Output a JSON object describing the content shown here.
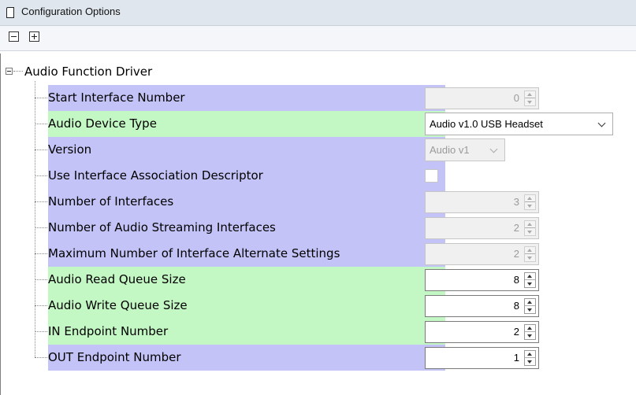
{
  "window": {
    "title": "Configuration Options"
  },
  "toolbar": {
    "collapse_all_icon": "minus-box-icon",
    "expand_all_icon": "plus-box-icon"
  },
  "tree": {
    "root_label": "Audio Function Driver",
    "rows": [
      {
        "label": "Start Interface Number",
        "control": "spinner",
        "value": "0",
        "enabled": false,
        "color": "#c3c3f7"
      },
      {
        "label": "Audio Device Type",
        "control": "dropdown",
        "value": "Audio v1.0 USB Headset",
        "enabled": true,
        "color": "#c3f7c3"
      },
      {
        "label": "Version",
        "control": "dropdown",
        "value": "Audio v1",
        "enabled": false,
        "color": "#c3c3f7"
      },
      {
        "label": "Use Interface Association Descriptor",
        "control": "checkbox",
        "checked": false,
        "enabled": false,
        "color": "#c3c3f7"
      },
      {
        "label": "Number of Interfaces",
        "control": "spinner",
        "value": "3",
        "enabled": false,
        "color": "#c3c3f7"
      },
      {
        "label": "Number of Audio Streaming Interfaces",
        "control": "spinner",
        "value": "2",
        "enabled": false,
        "color": "#c3c3f7"
      },
      {
        "label": "Maximum Number of Interface Alternate Settings",
        "control": "spinner",
        "value": "2",
        "enabled": false,
        "color": "#c3c3f7"
      },
      {
        "label": "Audio Read Queue Size",
        "control": "spinner",
        "value": "8",
        "enabled": true,
        "color": "#c3f7c3"
      },
      {
        "label": "Audio Write Queue Size",
        "control": "spinner",
        "value": "8",
        "enabled": true,
        "color": "#c3f7c3"
      },
      {
        "label": "IN Endpoint Number",
        "control": "spinner",
        "value": "2",
        "enabled": true,
        "color": "#c3f7c3"
      },
      {
        "label": "OUT Endpoint Number",
        "control": "spinner",
        "value": "1",
        "enabled": true,
        "color": "#c3c3f7"
      }
    ]
  }
}
